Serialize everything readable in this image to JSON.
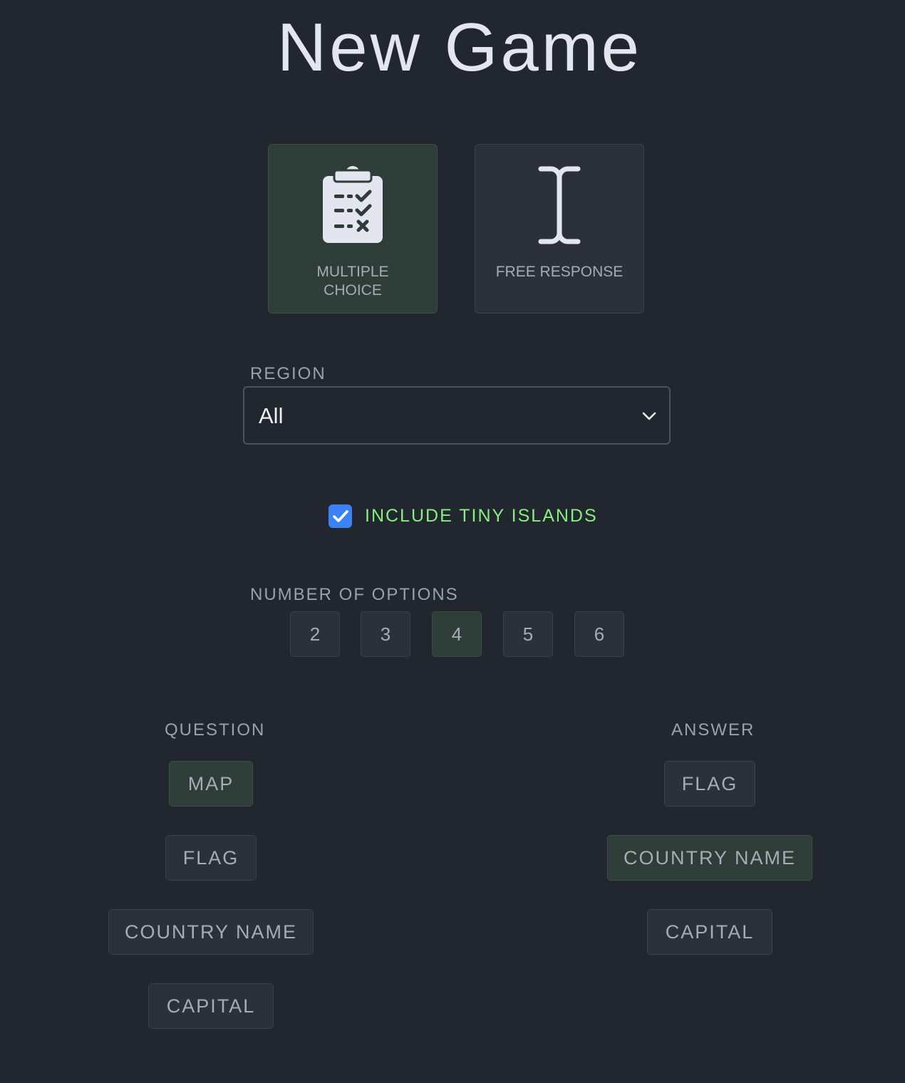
{
  "page": {
    "title": "New Game"
  },
  "modes": [
    {
      "line1": "MULTIPLE",
      "line2": "CHOICE",
      "icon": "clipboard-checklist-icon",
      "selected": true
    },
    {
      "line1": "FREE RESPONSE",
      "line2": "",
      "icon": "text-cursor-icon",
      "selected": false
    }
  ],
  "region": {
    "label": "REGION",
    "value": "All",
    "icon": "chevron-down-icon"
  },
  "tiny_islands": {
    "label": "INCLUDE TINY ISLANDS",
    "checked": true,
    "color": "#86ef7e"
  },
  "options": {
    "label": "NUMBER OF OPTIONS",
    "values": [
      "2",
      "3",
      "4",
      "5",
      "6"
    ],
    "selected": "4"
  },
  "question": {
    "label": "QUESTION",
    "items": [
      "MAP",
      "FLAG",
      "COUNTRY NAME",
      "CAPITAL"
    ],
    "selected": "MAP"
  },
  "answer": {
    "label": "ANSWER",
    "items": [
      "FLAG",
      "COUNTRY NAME",
      "CAPITAL"
    ],
    "selected": "COUNTRY NAME"
  },
  "colors": {
    "background": "#22262f",
    "card": "#2c303a",
    "selected": "#2e3d37",
    "accent_blue": "#3b82f6",
    "accent_green": "#86ef7e"
  }
}
